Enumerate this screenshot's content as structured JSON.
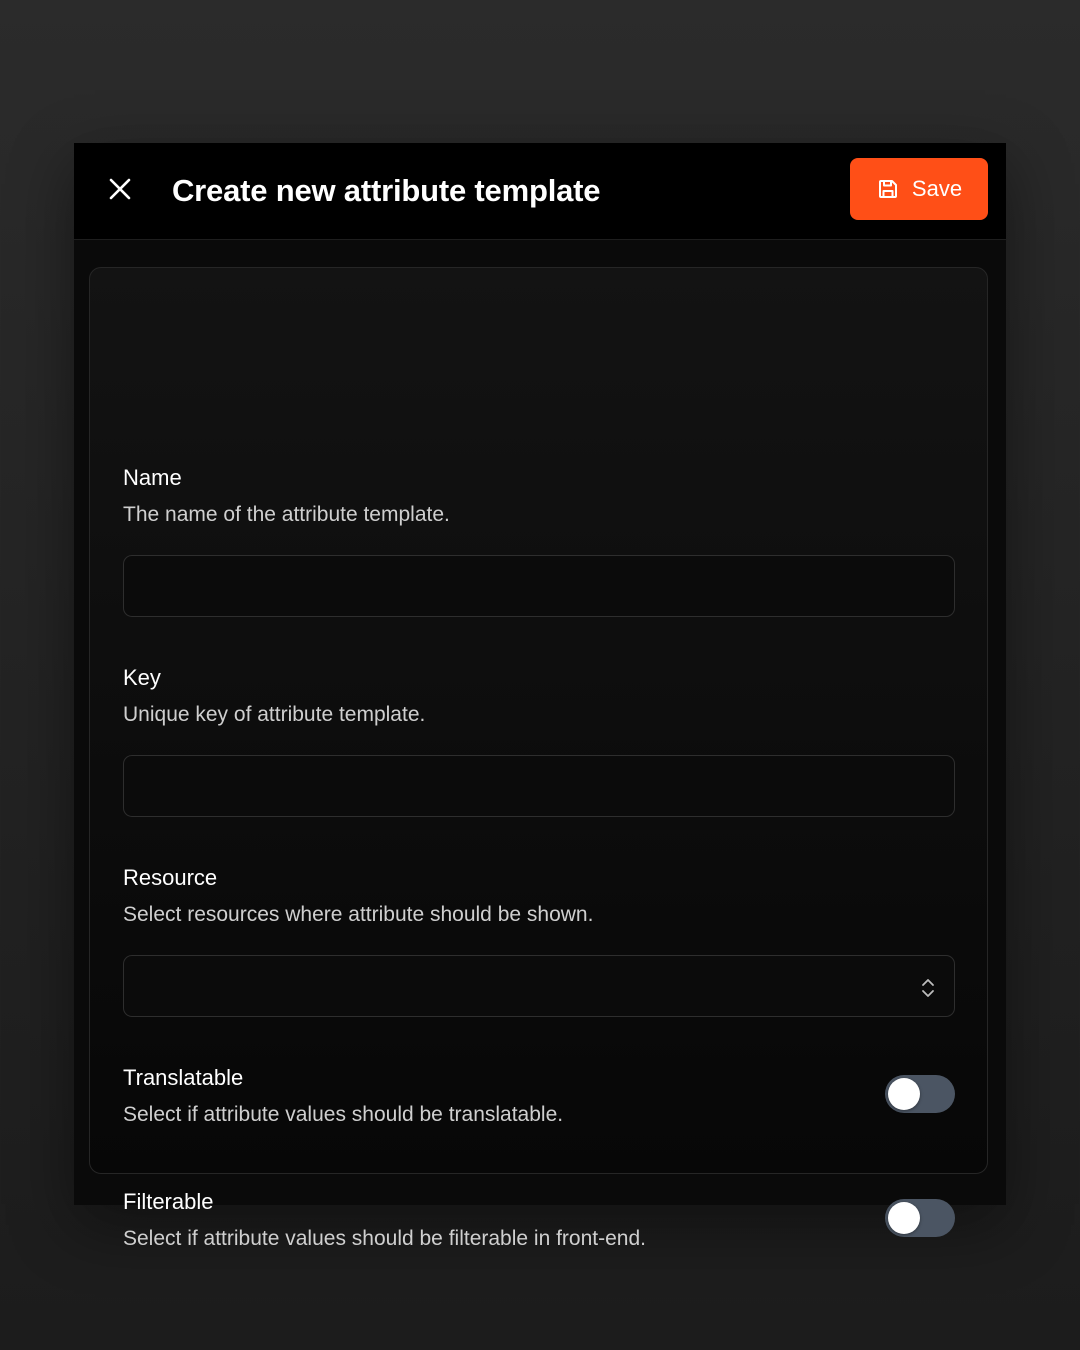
{
  "header": {
    "title": "Create new attribute template",
    "save_label": "Save",
    "close_icon": "close-icon",
    "save_icon": "floppy-disk-icon"
  },
  "colors": {
    "accent": "#ff4f17",
    "toggle_off": "#4b5563"
  },
  "form": {
    "name": {
      "label": "Name",
      "description": "The name of the attribute template.",
      "value": ""
    },
    "key": {
      "label": "Key",
      "description": "Unique key of attribute template.",
      "value": ""
    },
    "resource": {
      "label": "Resource",
      "description": "Select resources where attribute should be shown.",
      "selected": ""
    },
    "translatable": {
      "label": "Translatable",
      "description": "Select if attribute values should be translatable.",
      "enabled": false
    },
    "filterable": {
      "label": "Filterable",
      "description": "Select if attribute values should be filterable in front-end.",
      "enabled": false
    }
  }
}
